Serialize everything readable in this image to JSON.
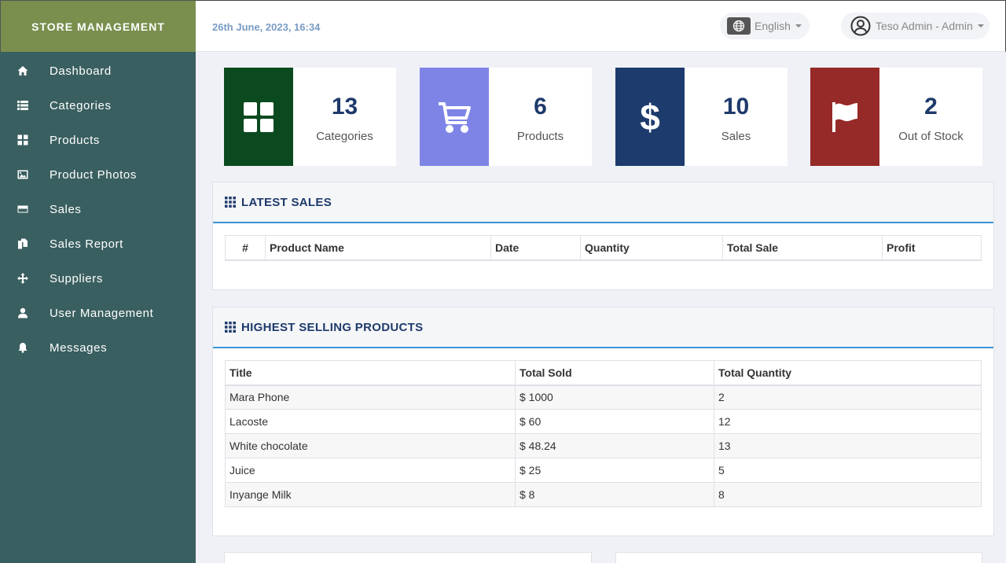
{
  "brand": "STORE MANAGEMENT",
  "header": {
    "datetime": "26th June, 2023, 16:34",
    "language": "English",
    "user": "Teso Admin - Admin"
  },
  "nav": [
    {
      "label": "Dashboard",
      "icon": "home-icon"
    },
    {
      "label": "Categories",
      "icon": "list-icon"
    },
    {
      "label": "Products",
      "icon": "grid-icon"
    },
    {
      "label": "Product Photos",
      "icon": "image-icon"
    },
    {
      "label": "Sales",
      "icon": "credit-card-icon"
    },
    {
      "label": "Sales Report",
      "icon": "report-icon"
    },
    {
      "label": "Suppliers",
      "icon": "move-icon"
    },
    {
      "label": "User Management",
      "icon": "user-icon"
    },
    {
      "label": "Messages",
      "icon": "bell-icon"
    }
  ],
  "stats": [
    {
      "value": "13",
      "label": "Categories",
      "color": "#0b4a1f",
      "icon": "grid-icon"
    },
    {
      "value": "6",
      "label": "Products",
      "color": "#7d84e6",
      "icon": "cart-icon"
    },
    {
      "value": "10",
      "label": "Sales",
      "color": "#1d3b6d",
      "icon": "dollar-icon"
    },
    {
      "value": "2",
      "label": "Out of Stock",
      "color": "#952a28",
      "icon": "flag-icon"
    }
  ],
  "latest_sales": {
    "title": "LATEST SALES",
    "columns": [
      "#",
      "Product Name",
      "Date",
      "Quantity",
      "Total Sale",
      "Profit"
    ],
    "rows": []
  },
  "highest_selling": {
    "title": "HIGHEST SELLING PRODUCTS",
    "columns": [
      "Title",
      "Total Sold",
      "Total Quantity"
    ],
    "rows": [
      [
        "Mara Phone",
        "$ 1000",
        "2"
      ],
      [
        "Lacoste",
        "$ 60",
        "12"
      ],
      [
        "White chocolate",
        "$ 48.24",
        "13"
      ],
      [
        "Juice",
        "$ 25",
        "5"
      ],
      [
        "Inyange Milk",
        "$ 8",
        "8"
      ]
    ]
  },
  "colors": {
    "sidebar": "#3a5f60",
    "brand": "#7a8f4e",
    "accent": "#3a95d6",
    "heading": "#1e3a6b"
  }
}
